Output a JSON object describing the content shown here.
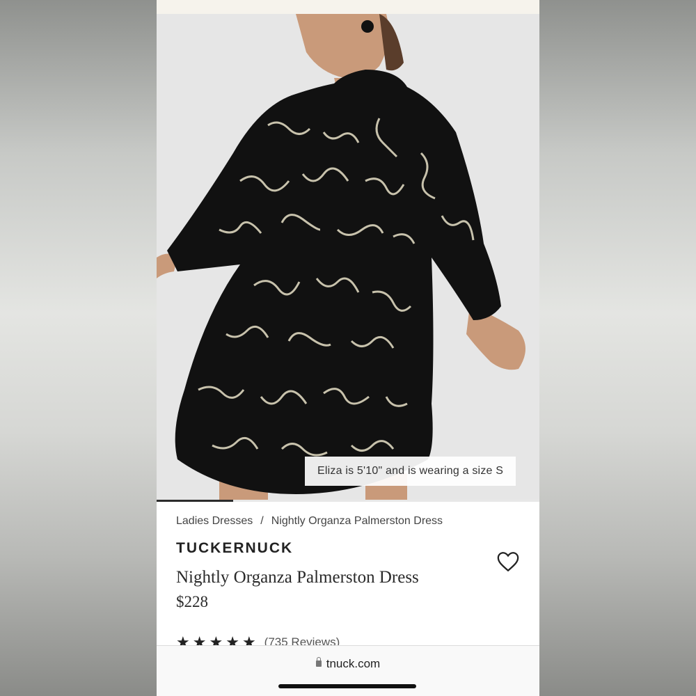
{
  "image_caption": "Eliza is 5'10\" and is wearing a size S",
  "carousel": {
    "progress_fraction": 0.2
  },
  "breadcrumb": {
    "items": [
      "Ladies Dresses",
      "Nightly Organza Palmerston Dress"
    ],
    "separator": "/"
  },
  "product": {
    "brand": "TUCKERNUCK",
    "title": "Nightly Organza Palmerston Dress",
    "price": "$228",
    "rating_stars": 4.5,
    "reviews_label": "(735 Reviews)"
  },
  "browser": {
    "url": "tnuck.com"
  },
  "icons": {
    "favorite": "heart-icon",
    "secure": "lock-icon"
  },
  "colors": {
    "text": "#222222",
    "hero_bg": "#e6e6e6",
    "dress": "#111111",
    "pattern": "#e8e2c8"
  }
}
